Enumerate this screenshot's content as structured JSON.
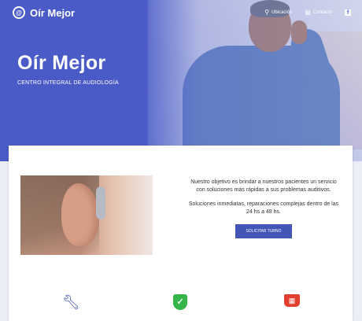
{
  "brand": {
    "logo_glyph": "@",
    "name": "Oír Mejor"
  },
  "topnav": {
    "location_icon": "map-pin-icon",
    "location_label": "Ubicación",
    "contact_icon": "chat-icon",
    "contact_label": "Contacto",
    "social_icon": "facebook-icon"
  },
  "hero": {
    "title": "Oír Mejor",
    "subtitle": "CENTRO INTEGRAL DE AUDIOLOGÍA"
  },
  "intro": {
    "paragraph_1": "Nuestro objetivo es brindar a nuestros pacientes un servicio con soluciones más rápidas a sus problemas auditivos.",
    "paragraph_2": "Soluciones inmediatas, reparaciones complejas dentro de las 24 hs a 48 hs.",
    "cta_label": "SOLICITAR TURNO"
  },
  "features": [
    {
      "icon": "wrench-icon"
    },
    {
      "icon": "shield-check-icon"
    },
    {
      "icon": "basket-icon"
    }
  ],
  "colors": {
    "primary": "#4a5bc8",
    "button": "#4356b8",
    "wrench": "#3f51b5",
    "shield": "#35b44a",
    "basket": "#e0402d"
  }
}
